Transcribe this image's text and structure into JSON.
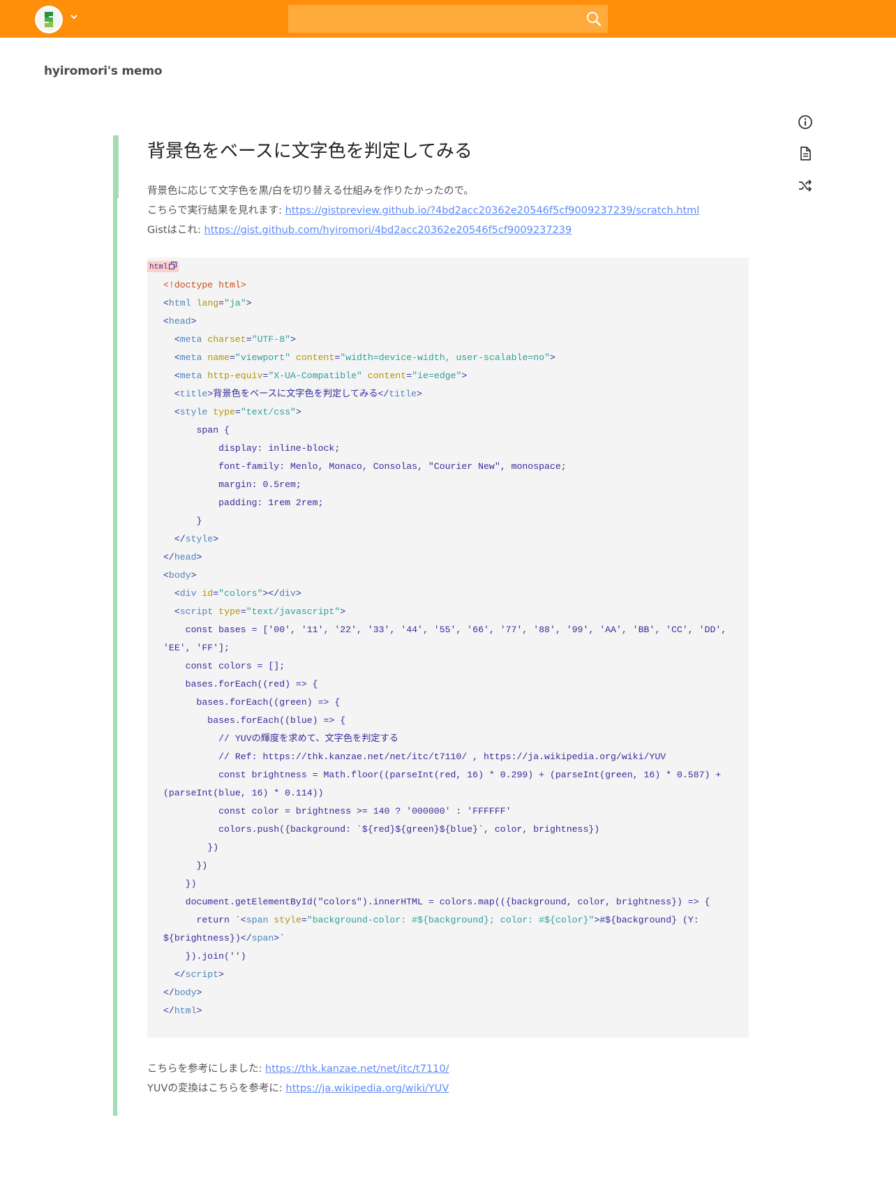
{
  "header": {
    "search_placeholder": ""
  },
  "project": {
    "name": "hyiromori's memo"
  },
  "page": {
    "title": "背景色をベースに文字色を判定してみる",
    "intro": [
      {
        "text": "背景色に応じて文字色を黒/白を切り替える仕組みを作りたかったので。",
        "link": ""
      },
      {
        "text": "こちらで実行結果を見れます: ",
        "link": "https://gistpreview.github.io/?4bd2acc20362e20546f5cf9009237239/scratch.html"
      },
      {
        "text": "Gistはこれ: ",
        "link": "https://gist.github.com/hyiromori/4bd2acc20362e20546f5cf9009237239"
      }
    ],
    "code": {
      "language": "html",
      "lines": [
        [
          [
            "d",
            "<!doctype html>"
          ]
        ],
        [
          [
            "p",
            "<"
          ],
          [
            "t",
            "html"
          ],
          [
            "p",
            " "
          ],
          [
            "a",
            "lang"
          ],
          [
            "p",
            "="
          ],
          [
            "s",
            "\"ja\""
          ],
          [
            "p",
            ">"
          ]
        ],
        [
          [
            "p",
            "<"
          ],
          [
            "t",
            "head"
          ],
          [
            "p",
            ">"
          ]
        ],
        [
          [
            "p",
            "  <"
          ],
          [
            "t",
            "meta"
          ],
          [
            "p",
            " "
          ],
          [
            "a",
            "charset"
          ],
          [
            "p",
            "="
          ],
          [
            "s",
            "\"UTF-8\""
          ],
          [
            "p",
            ">"
          ]
        ],
        [
          [
            "p",
            "  <"
          ],
          [
            "t",
            "meta"
          ],
          [
            "p",
            " "
          ],
          [
            "a",
            "name"
          ],
          [
            "p",
            "="
          ],
          [
            "s",
            "\"viewport\""
          ],
          [
            "p",
            " "
          ],
          [
            "a",
            "content"
          ],
          [
            "p",
            "="
          ],
          [
            "s",
            "\"width=device-width, user-scalable=no\""
          ],
          [
            "p",
            ">"
          ]
        ],
        [
          [
            "p",
            "  <"
          ],
          [
            "t",
            "meta"
          ],
          [
            "p",
            " "
          ],
          [
            "a",
            "http-equiv"
          ],
          [
            "p",
            "="
          ],
          [
            "s",
            "\"X-UA-Compatible\""
          ],
          [
            "p",
            " "
          ],
          [
            "a",
            "content"
          ],
          [
            "p",
            "="
          ],
          [
            "s",
            "\"ie=edge\""
          ],
          [
            "p",
            ">"
          ]
        ],
        [
          [
            "p",
            "  <"
          ],
          [
            "t",
            "title"
          ],
          [
            "p",
            ">背景色をベースに文字色を判定してみる</"
          ],
          [
            "t",
            "title"
          ],
          [
            "p",
            ">"
          ]
        ],
        [
          [
            "p",
            "  <"
          ],
          [
            "t",
            "style"
          ],
          [
            "p",
            " "
          ],
          [
            "a",
            "type"
          ],
          [
            "p",
            "="
          ],
          [
            "s",
            "\"text/css\""
          ],
          [
            "p",
            ">"
          ]
        ],
        [
          [
            "p",
            "      span {"
          ]
        ],
        [
          [
            "p",
            "          display: inline-block;"
          ]
        ],
        [
          [
            "p",
            "          font-family: Menlo, Monaco, Consolas, \"Courier New\", monospace;"
          ]
        ],
        [
          [
            "p",
            "          margin: 0.5rem;"
          ]
        ],
        [
          [
            "p",
            "          padding: 1rem 2rem;"
          ]
        ],
        [
          [
            "p",
            "      }"
          ]
        ],
        [
          [
            "p",
            "  </"
          ],
          [
            "t",
            "style"
          ],
          [
            "p",
            ">"
          ]
        ],
        [
          [
            "p",
            "</"
          ],
          [
            "t",
            "head"
          ],
          [
            "p",
            ">"
          ]
        ],
        [
          [
            "p",
            "<"
          ],
          [
            "t",
            "body"
          ],
          [
            "p",
            ">"
          ]
        ],
        [
          [
            "p",
            "  <"
          ],
          [
            "t",
            "div"
          ],
          [
            "p",
            " "
          ],
          [
            "a",
            "id"
          ],
          [
            "p",
            "="
          ],
          [
            "s",
            "\"colors\""
          ],
          [
            "p",
            "></"
          ],
          [
            "t",
            "div"
          ],
          [
            "p",
            ">"
          ]
        ],
        [
          [
            "p",
            "  <"
          ],
          [
            "t",
            "script"
          ],
          [
            "p",
            " "
          ],
          [
            "a",
            "type"
          ],
          [
            "p",
            "="
          ],
          [
            "s",
            "\"text/javascript\""
          ],
          [
            "p",
            ">"
          ]
        ],
        [
          [
            "p",
            "    const bases = ['00', '11', '22', '33', '44', '55', '66', '77', '88', '99', 'AA', 'BB', 'CC', 'DD',"
          ]
        ],
        [
          [
            "p",
            "'EE', 'FF'];"
          ]
        ],
        [
          [
            "p",
            "    const colors = [];"
          ]
        ],
        [
          [
            "p",
            "    bases.forEach((red) => {"
          ]
        ],
        [
          [
            "p",
            "      bases.forEach((green) => {"
          ]
        ],
        [
          [
            "p",
            "        bases.forEach((blue) => {"
          ]
        ],
        [
          [
            "p",
            "          // YUVの輝度を求めて、文字色を判定する"
          ]
        ],
        [
          [
            "p",
            "          // Ref: https://thk.kanzae.net/net/itc/t7110/ , https://ja.wikipedia.org/wiki/YUV"
          ]
        ],
        [
          [
            "p",
            "          const brightness = Math.floor((parseInt(red, 16) * 0.299) + (parseInt(green, 16) * 0.587) +"
          ]
        ],
        [
          [
            "p",
            "(parseInt(blue, 16) * 0.114))"
          ]
        ],
        [
          [
            "p",
            "          const color = brightness >= 140 ? '000000' : 'FFFFFF'"
          ]
        ],
        [
          [
            "p",
            "          colors.push({background: `${red}${green}${blue}`, color, brightness})"
          ]
        ],
        [
          [
            "p",
            "        })"
          ]
        ],
        [
          [
            "p",
            "      })"
          ]
        ],
        [
          [
            "p",
            "    })"
          ]
        ],
        [
          [
            "p",
            "    document.getElementById(\"colors\").innerHTML = colors.map(({background, color, brightness}) => {"
          ]
        ],
        [
          [
            "p",
            "      return `<"
          ],
          [
            "t",
            "span"
          ],
          [
            "p",
            " "
          ],
          [
            "a",
            "style"
          ],
          [
            "p",
            "="
          ],
          [
            "s",
            "\"background-color: #${background}; color: #${color}\""
          ],
          [
            "p",
            ">#${background} (Y:"
          ]
        ],
        [
          [
            "p",
            "${brightness})</"
          ],
          [
            "t",
            "span"
          ],
          [
            "p",
            ">`"
          ]
        ],
        [
          [
            "p",
            "    }).join('')"
          ]
        ],
        [
          [
            "p",
            "  </"
          ],
          [
            "t",
            "script"
          ],
          [
            "p",
            ">"
          ]
        ],
        [
          [
            "p",
            "</"
          ],
          [
            "t",
            "body"
          ],
          [
            "p",
            ">"
          ]
        ],
        [
          [
            "p",
            "</"
          ],
          [
            "t",
            "html"
          ],
          [
            "p",
            ">"
          ]
        ]
      ]
    },
    "footer": [
      {
        "text": "こちらを参考にしました: ",
        "link": "https://thk.kanzae.net/net/itc/t7110/"
      },
      {
        "text": "YUVの変換はこちらを参考に: ",
        "link": "https://ja.wikipedia.org/wiki/YUV"
      }
    ]
  },
  "icons": {
    "logo": "scrapbox-logo-icon",
    "caret": "chevron-down-icon",
    "search": "search-icon",
    "info": "info-icon",
    "document": "document-icon",
    "shuffle": "shuffle-icon",
    "copy": "copy-icon"
  },
  "colors": {
    "header": "#ff8f0a",
    "search_bg": "#ffab3c",
    "page_line": "#a3dbb4",
    "link": "#5e8af7",
    "code_bg": "#f4f4f4",
    "code_label_bg": "#ffcfc6"
  }
}
